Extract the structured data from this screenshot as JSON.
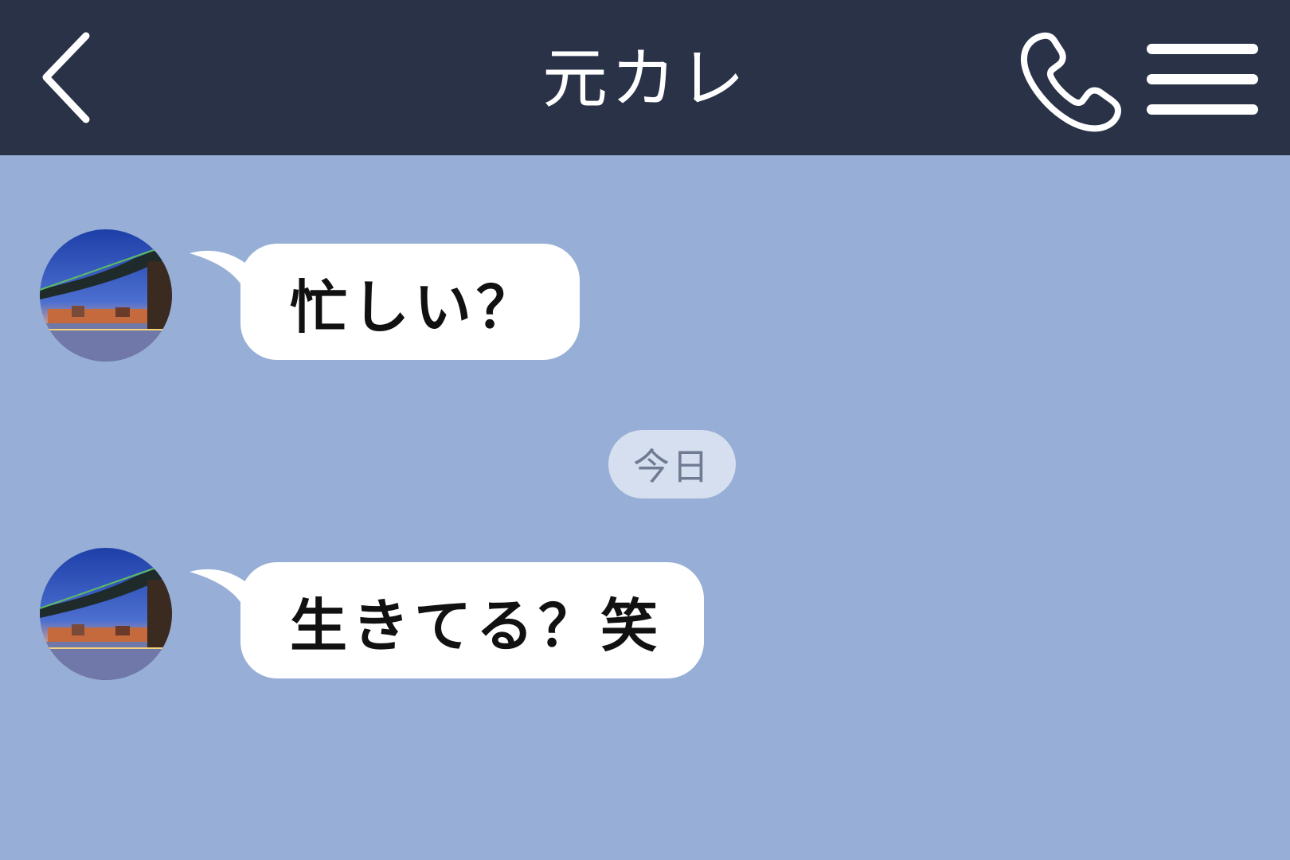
{
  "header": {
    "title": "元カレ",
    "back_icon": "chevron-left-icon",
    "call_icon": "phone-icon",
    "menu_icon": "hamburger-menu-icon"
  },
  "messages": [
    {
      "sender": "contact",
      "text": "忙しい？",
      "avatar_icon": "bridge-night-avatar"
    },
    {
      "sender": "contact",
      "text": "生きてる？笑",
      "avatar_icon": "bridge-night-avatar"
    }
  ],
  "date_separator": "今日",
  "colors": {
    "header_bg": "#2a3248",
    "chat_bg": "#97aed6",
    "bubble_bg": "#ffffff",
    "date_pill_bg": "#d5dfef",
    "date_pill_text": "#6f7b93"
  }
}
